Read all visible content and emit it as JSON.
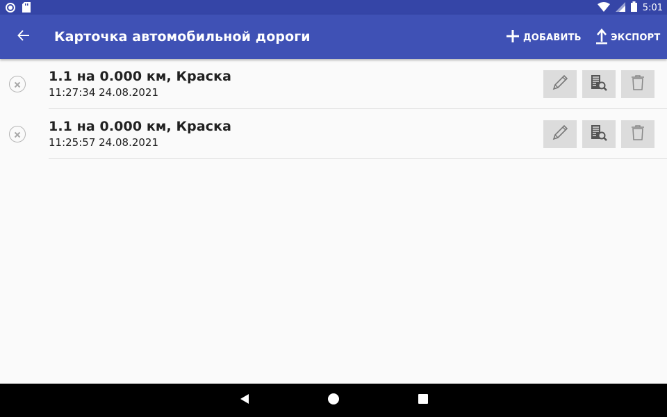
{
  "status_bar": {
    "time": "5:01",
    "left_icons": [
      "circle-notification-icon",
      "sd-card-icon"
    ],
    "right_icons": [
      "wifi-icon",
      "cell-signal-icon",
      "battery-icon"
    ],
    "background": "#3545a7"
  },
  "app_bar": {
    "title": "Карточка автомобильной дороги",
    "back_icon": "arrow-left-icon",
    "add_label": "ДОБАВИТЬ",
    "export_label": "ЭКСПОРТ",
    "background": "#3f51b5"
  },
  "list": {
    "items": [
      {
        "title": "1.1 на 0.000 км, Краска",
        "date": "11:27:34 24.08.2021"
      },
      {
        "title": "1.1 на 0.000 км, Краска",
        "date": "11:25:57 24.08.2021"
      }
    ],
    "row_actions": [
      "pencil-icon",
      "document-search-icon",
      "trash-icon"
    ]
  },
  "nav_bar": {
    "buttons": [
      "nav-back-icon",
      "nav-home-icon",
      "nav-recent-icon"
    ]
  }
}
